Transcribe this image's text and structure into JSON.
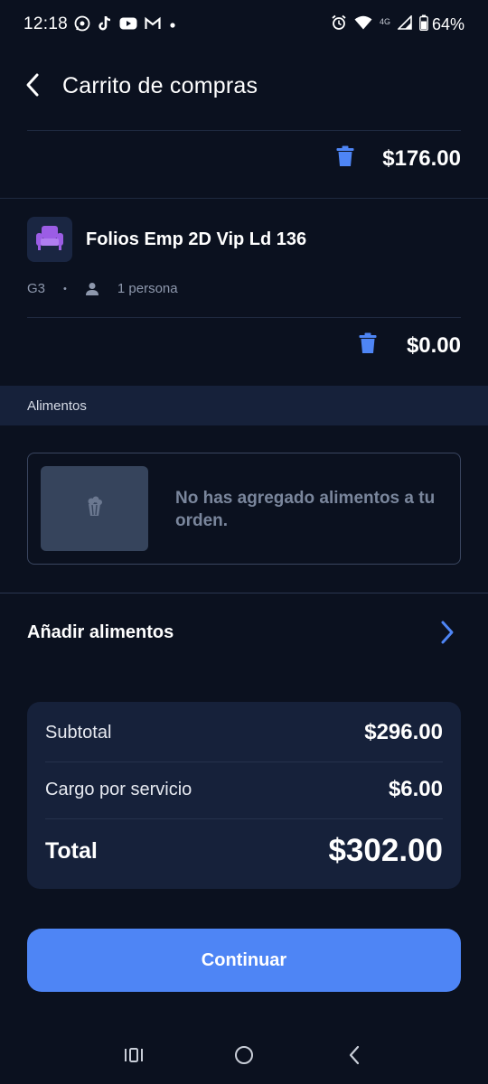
{
  "status_bar": {
    "time": "12:18",
    "battery": "64%",
    "network": "4G",
    "left_icons": [
      "whatsapp-icon",
      "tiktok-icon",
      "youtube-icon",
      "gmail-icon",
      "dot-icon"
    ],
    "right_icons": [
      "alarm-icon",
      "wifi-icon",
      "signal-icon",
      "battery-icon"
    ]
  },
  "header": {
    "title": "Carrito de compras"
  },
  "first_item": {
    "price": "$176.00"
  },
  "ticket": {
    "name": "Folios Emp 2D Vip Ld 136",
    "seat": "G3",
    "separator": "•",
    "people": "1 persona",
    "price": "$0.00"
  },
  "food_section": {
    "label": "Alimentos",
    "empty_message": "No has agregado alimentos a tu orden.",
    "add_label": "Añadir alimentos"
  },
  "summary": {
    "subtotal_label": "Subtotal",
    "subtotal_value": "$296.00",
    "service_label": "Cargo por servicio",
    "service_value": "$6.00",
    "total_label": "Total",
    "total_value": "$302.00"
  },
  "continue_label": "Continuar",
  "colors": {
    "background": "#0b111f",
    "card": "#16213a",
    "accent": "#4e85f5",
    "seat_icon": "#9b5de5",
    "muted": "#7a869c"
  }
}
